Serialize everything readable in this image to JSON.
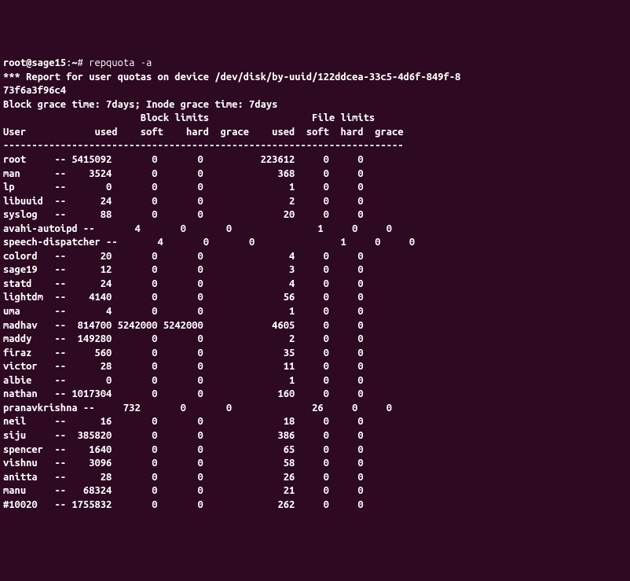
{
  "prompt": {
    "user_host": "root@sage15",
    "path": "~",
    "symbol": "#",
    "command": "repquota -a"
  },
  "header": {
    "title": "*** Report for user quotas on device /dev/disk/by-uuid/122ddcea-33c5-4d6f-849f-8",
    "title2": "73f6a3f96c4",
    "grace": "Block grace time: 7days; Inode grace time: 7days",
    "section1": "Block limits",
    "section2": "File limits",
    "cols": "User            used    soft    hard  grace    used  soft  hard  grace",
    "separator": "----------------------------------------------------------------------"
  },
  "rows": [
    {
      "user": "root",
      "flag": "--",
      "bused": "5415092",
      "bsoft": "0",
      "bhard": "0",
      "bgrace": "",
      "fused": "223612",
      "fsoft": "0",
      "fhard": "0",
      "fgrace": ""
    },
    {
      "user": "man",
      "flag": "--",
      "bused": "3524",
      "bsoft": "0",
      "bhard": "0",
      "bgrace": "",
      "fused": "368",
      "fsoft": "0",
      "fhard": "0",
      "fgrace": ""
    },
    {
      "user": "lp",
      "flag": "--",
      "bused": "0",
      "bsoft": "0",
      "bhard": "0",
      "bgrace": "",
      "fused": "1",
      "fsoft": "0",
      "fhard": "0",
      "fgrace": ""
    },
    {
      "user": "libuuid",
      "flag": "--",
      "bused": "24",
      "bsoft": "0",
      "bhard": "0",
      "bgrace": "",
      "fused": "2",
      "fsoft": "0",
      "fhard": "0",
      "fgrace": ""
    },
    {
      "user": "syslog",
      "flag": "--",
      "bused": "88",
      "bsoft": "0",
      "bhard": "0",
      "bgrace": "",
      "fused": "20",
      "fsoft": "0",
      "fhard": "0",
      "fgrace": ""
    },
    {
      "user": "avahi-autoipd",
      "flag": "--",
      "bused": "4",
      "bsoft": "0",
      "bhard": "0",
      "bgrace": "",
      "fused": "1",
      "fsoft": "0",
      "fhard": "0",
      "fgrace": "",
      "long": true
    },
    {
      "user": "speech-dispatcher",
      "flag": "--",
      "bused": "4",
      "bsoft": "0",
      "bhard": "0",
      "bgrace": "",
      "fused": "1",
      "fsoft": "0",
      "fhard": "0",
      "fgrace": "",
      "long": true
    },
    {
      "user": "colord",
      "flag": "--",
      "bused": "20",
      "bsoft": "0",
      "bhard": "0",
      "bgrace": "",
      "fused": "4",
      "fsoft": "0",
      "fhard": "0",
      "fgrace": ""
    },
    {
      "user": "sage19",
      "flag": "--",
      "bused": "12",
      "bsoft": "0",
      "bhard": "0",
      "bgrace": "",
      "fused": "3",
      "fsoft": "0",
      "fhard": "0",
      "fgrace": ""
    },
    {
      "user": "statd",
      "flag": "--",
      "bused": "24",
      "bsoft": "0",
      "bhard": "0",
      "bgrace": "",
      "fused": "4",
      "fsoft": "0",
      "fhard": "0",
      "fgrace": ""
    },
    {
      "user": "lightdm",
      "flag": "--",
      "bused": "4140",
      "bsoft": "0",
      "bhard": "0",
      "bgrace": "",
      "fused": "56",
      "fsoft": "0",
      "fhard": "0",
      "fgrace": ""
    },
    {
      "user": "uma",
      "flag": "--",
      "bused": "4",
      "bsoft": "0",
      "bhard": "0",
      "bgrace": "",
      "fused": "1",
      "fsoft": "0",
      "fhard": "0",
      "fgrace": ""
    },
    {
      "user": "madhav",
      "flag": "--",
      "bused": "814700",
      "bsoft": "5242000",
      "bhard": "5242000",
      "bgrace": "",
      "fused": "4605",
      "fsoft": "0",
      "fhard": "0",
      "fgrace": ""
    },
    {
      "user": "maddy",
      "flag": "--",
      "bused": "149280",
      "bsoft": "0",
      "bhard": "0",
      "bgrace": "",
      "fused": "2",
      "fsoft": "0",
      "fhard": "0",
      "fgrace": ""
    },
    {
      "user": "firaz",
      "flag": "--",
      "bused": "560",
      "bsoft": "0",
      "bhard": "0",
      "bgrace": "",
      "fused": "35",
      "fsoft": "0",
      "fhard": "0",
      "fgrace": ""
    },
    {
      "user": "victor",
      "flag": "--",
      "bused": "28",
      "bsoft": "0",
      "bhard": "0",
      "bgrace": "",
      "fused": "11",
      "fsoft": "0",
      "fhard": "0",
      "fgrace": ""
    },
    {
      "user": "albie",
      "flag": "--",
      "bused": "0",
      "bsoft": "0",
      "bhard": "0",
      "bgrace": "",
      "fused": "1",
      "fsoft": "0",
      "fhard": "0",
      "fgrace": ""
    },
    {
      "user": "nathan",
      "flag": "--",
      "bused": "1017304",
      "bsoft": "0",
      "bhard": "0",
      "bgrace": "",
      "fused": "160",
      "fsoft": "0",
      "fhard": "0",
      "fgrace": ""
    },
    {
      "user": "pranavkrishna",
      "flag": "--",
      "bused": "732",
      "bsoft": "0",
      "bhard": "0",
      "bgrace": "",
      "fused": "26",
      "fsoft": "0",
      "fhard": "0",
      "fgrace": "",
      "long": true
    },
    {
      "user": "neil",
      "flag": "--",
      "bused": "16",
      "bsoft": "0",
      "bhard": "0",
      "bgrace": "",
      "fused": "18",
      "fsoft": "0",
      "fhard": "0",
      "fgrace": ""
    },
    {
      "user": "siju",
      "flag": "--",
      "bused": "385820",
      "bsoft": "0",
      "bhard": "0",
      "bgrace": "",
      "fused": "386",
      "fsoft": "0",
      "fhard": "0",
      "fgrace": ""
    },
    {
      "user": "spencer",
      "flag": "--",
      "bused": "1640",
      "bsoft": "0",
      "bhard": "0",
      "bgrace": "",
      "fused": "65",
      "fsoft": "0",
      "fhard": "0",
      "fgrace": ""
    },
    {
      "user": "vishnu",
      "flag": "--",
      "bused": "3096",
      "bsoft": "0",
      "bhard": "0",
      "bgrace": "",
      "fused": "58",
      "fsoft": "0",
      "fhard": "0",
      "fgrace": ""
    },
    {
      "user": "anitta",
      "flag": "--",
      "bused": "28",
      "bsoft": "0",
      "bhard": "0",
      "bgrace": "",
      "fused": "26",
      "fsoft": "0",
      "fhard": "0",
      "fgrace": ""
    },
    {
      "user": "manu",
      "flag": "--",
      "bused": "68324",
      "bsoft": "0",
      "bhard": "0",
      "bgrace": "",
      "fused": "21",
      "fsoft": "0",
      "fhard": "0",
      "fgrace": ""
    },
    {
      "user": "#10020",
      "flag": "--",
      "bused": "1755832",
      "bsoft": "0",
      "bhard": "0",
      "bgrace": "",
      "fused": "262",
      "fsoft": "0",
      "fhard": "0",
      "fgrace": ""
    }
  ]
}
